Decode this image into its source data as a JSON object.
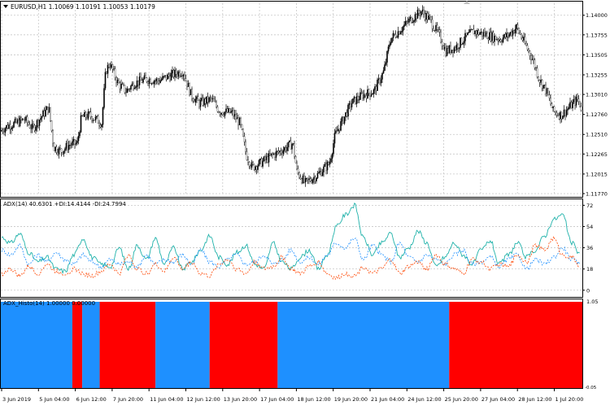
{
  "main_panel": {
    "label": "EURUSD,H1  1.10069 1.10191 1.10053 1.10179",
    "price_ticks": [
      "1.14000",
      "1.13755",
      "1.13505",
      "1.13255",
      "1.13010",
      "1.12760",
      "1.12510",
      "1.12265",
      "1.12015",
      "1.11770"
    ],
    "collapse_icon": "triangle-down-icon",
    "scroll_icon": "triangle-up-icon"
  },
  "adx_panel": {
    "label": "ADX(14) 40.6301 +DI:14.4144 -DI:24.7994",
    "ticks": [
      "72",
      "54",
      "36",
      "18",
      "0"
    ]
  },
  "histo_panel": {
    "label": "ADX_Histo(14) 1.00000 0.00000",
    "ticks": [
      "1.05",
      "-0.05"
    ]
  },
  "time_axis": {
    "labels": [
      "3 Jun 2019",
      "5 Jun 04:00",
      "6 Jun 12:00",
      "7 Jun 20:00",
      "11 Jun 04:00",
      "12 Jun 12:00",
      "13 Jun 20:00",
      "17 Jun 04:00",
      "18 Jun 12:00",
      "19 Jun 20:00",
      "21 Jun 04:00",
      "24 Jun 12:00",
      "25 Jun 20:00",
      "27 Jun 04:00",
      "28 Jun 12:00",
      "1 Jul 20:00"
    ]
  },
  "colors": {
    "bull": "#1e90ff",
    "bear": "#ff0000",
    "adx_line": "#20b2aa",
    "plus_di": "#1e90ff",
    "minus_di": "#ff4500",
    "grid": "#c8c8c8"
  },
  "chart_data": [
    {
      "type": "candlestick",
      "title": "EURUSD,H1",
      "ylim": [
        1.1177,
        1.1415
      ],
      "close_path": [
        [
          0,
          1.1255
        ],
        [
          10,
          1.1262
        ],
        [
          20,
          1.1265
        ],
        [
          30,
          1.127
        ],
        [
          40,
          1.1258
        ],
        [
          50,
          1.1272
        ],
        [
          60,
          1.1285
        ],
        [
          66,
          1.1235
        ],
        [
          75,
          1.123
        ],
        [
          85,
          1.1238
        ],
        [
          95,
          1.124
        ],
        [
          100,
          1.1272
        ],
        [
          110,
          1.1275
        ],
        [
          125,
          1.1265
        ],
        [
          130,
          1.133
        ],
        [
          135,
          1.134
        ],
        [
          145,
          1.1315
        ],
        [
          155,
          1.1305
        ],
        [
          165,
          1.1315
        ],
        [
          180,
          1.132
        ],
        [
          195,
          1.1318
        ],
        [
          210,
          1.1325
        ],
        [
          225,
          1.133
        ],
        [
          235,
          1.13
        ],
        [
          245,
          1.129
        ],
        [
          260,
          1.1295
        ],
        [
          270,
          1.128
        ],
        [
          285,
          1.1278
        ],
        [
          295,
          1.1265
        ],
        [
          303,
          1.1225
        ],
        [
          310,
          1.121
        ],
        [
          320,
          1.1215
        ],
        [
          335,
          1.1225
        ],
        [
          345,
          1.123
        ],
        [
          360,
          1.124
        ],
        [
          365,
          1.1205
        ],
        [
          375,
          1.119
        ],
        [
          390,
          1.12
        ],
        [
          405,
          1.1215
        ],
        [
          412,
          1.125
        ],
        [
          422,
          1.127
        ],
        [
          432,
          1.129
        ],
        [
          445,
          1.13
        ],
        [
          460,
          1.1305
        ],
        [
          472,
          1.133
        ],
        [
          480,
          1.137
        ],
        [
          495,
          1.1385
        ],
        [
          505,
          1.1395
        ],
        [
          518,
          1.1405
        ],
        [
          528,
          1.1395
        ],
        [
          540,
          1.1375
        ],
        [
          548,
          1.1355
        ],
        [
          560,
          1.136
        ],
        [
          570,
          1.137
        ],
        [
          582,
          1.138
        ],
        [
          600,
          1.1375
        ],
        [
          615,
          1.137
        ],
        [
          625,
          1.1375
        ],
        [
          635,
          1.1385
        ],
        [
          645,
          1.1365
        ],
        [
          655,
          1.1345
        ],
        [
          663,
          1.132
        ],
        [
          672,
          1.1305
        ],
        [
          680,
          1.128
        ],
        [
          690,
          1.1275
        ],
        [
          700,
          1.1285
        ],
        [
          710,
          1.1295
        ],
        [
          717,
          1.128
        ]
      ]
    },
    {
      "type": "line",
      "title": "ADX(14)",
      "ylim": [
        -5,
        75
      ],
      "series": [
        {
          "name": "ADX",
          "values": [
            45,
            40,
            48,
            32,
            24,
            28,
            18,
            16,
            30,
            44,
            28,
            22,
            20,
            36,
            18,
            38,
            26,
            44,
            22,
            36,
            18,
            24,
            34,
            46,
            28,
            22,
            32,
            38,
            22,
            18,
            40,
            24,
            18,
            28,
            34,
            18,
            30,
            54,
            64,
            72,
            44,
            30,
            40,
            48,
            28,
            36,
            50,
            40,
            20,
            28,
            40,
            30,
            22,
            34,
            42,
            22,
            30,
            40,
            28,
            34,
            46,
            60,
            64,
            40,
            30
          ]
        },
        {
          "name": "+DI",
          "values": [
            34,
            30,
            38,
            22,
            30,
            24,
            32,
            26,
            22,
            30,
            24,
            20,
            26,
            22,
            24,
            20,
            30,
            22,
            26,
            24,
            30,
            22,
            34,
            24,
            20,
            26,
            30,
            22,
            24,
            30,
            22,
            26,
            34,
            24,
            28,
            22,
            30,
            40,
            36,
            44,
            26,
            38,
            30,
            24,
            40,
            28,
            24,
            30,
            26,
            22,
            30,
            34,
            22,
            24,
            28,
            20,
            26,
            30,
            18,
            26,
            22,
            28,
            36,
            26,
            22
          ]
        },
        {
          "name": "-DI",
          "values": [
            14,
            18,
            12,
            20,
            14,
            22,
            16,
            14,
            18,
            14,
            12,
            16,
            22,
            14,
            30,
            18,
            14,
            22,
            16,
            28,
            18,
            24,
            14,
            12,
            22,
            26,
            18,
            14,
            24,
            18,
            20,
            28,
            18,
            14,
            20,
            24,
            14,
            10,
            14,
            12,
            20,
            14,
            18,
            26,
            14,
            20,
            24,
            18,
            30,
            22,
            18,
            14,
            26,
            24,
            18,
            22,
            20,
            30,
            24,
            38,
            34,
            44,
            30,
            28,
            20
          ]
        }
      ]
    },
    {
      "type": "bar",
      "title": "ADX_Histo(14)",
      "ylim": [
        -0.05,
        1.05
      ],
      "segments": [
        {
          "from": 0,
          "to": 12.3,
          "value": 1
        },
        {
          "from": 12.3,
          "to": 14.0,
          "value": 0
        },
        {
          "from": 14.0,
          "to": 17.0,
          "value": 1
        },
        {
          "from": 17.0,
          "to": 26.6,
          "value": 0
        },
        {
          "from": 26.6,
          "to": 35.9,
          "value": 1
        },
        {
          "from": 35.9,
          "to": 47.6,
          "value": 0
        },
        {
          "from": 47.6,
          "to": 77.1,
          "value": 1
        },
        {
          "from": 77.1,
          "to": 100,
          "value": 0
        }
      ]
    }
  ]
}
